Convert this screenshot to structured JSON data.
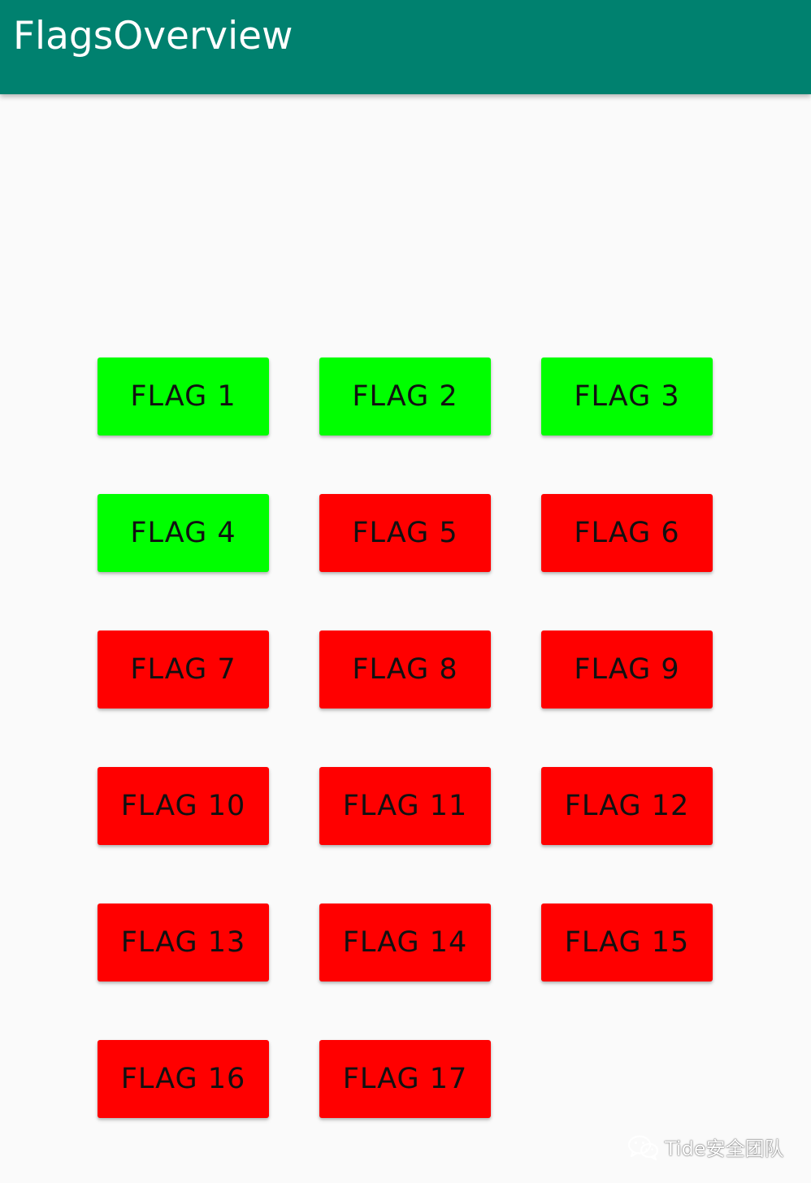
{
  "app_bar": {
    "title": "FlagsOverview",
    "background": "#00816f"
  },
  "colors": {
    "captured": "#00ff00",
    "pending": "#ff0000",
    "label": "#111111"
  },
  "flags": [
    {
      "label": "FLAG 1",
      "state": "captured"
    },
    {
      "label": "FLAG 2",
      "state": "captured"
    },
    {
      "label": "FLAG 3",
      "state": "captured"
    },
    {
      "label": "FLAG 4",
      "state": "captured"
    },
    {
      "label": "FLAG 5",
      "state": "pending"
    },
    {
      "label": "FLAG 6",
      "state": "pending"
    },
    {
      "label": "FLAG 7",
      "state": "pending"
    },
    {
      "label": "FLAG 8",
      "state": "pending"
    },
    {
      "label": "FLAG 9",
      "state": "pending"
    },
    {
      "label": "FLAG 10",
      "state": "pending"
    },
    {
      "label": "FLAG 11",
      "state": "pending"
    },
    {
      "label": "FLAG 12",
      "state": "pending"
    },
    {
      "label": "FLAG 13",
      "state": "pending"
    },
    {
      "label": "FLAG 14",
      "state": "pending"
    },
    {
      "label": "FLAG 15",
      "state": "pending"
    },
    {
      "label": "FLAG 16",
      "state": "pending"
    },
    {
      "label": "FLAG 17",
      "state": "pending"
    }
  ],
  "watermark": {
    "icon": "wechat-icon",
    "text": "Tide安全团队"
  }
}
